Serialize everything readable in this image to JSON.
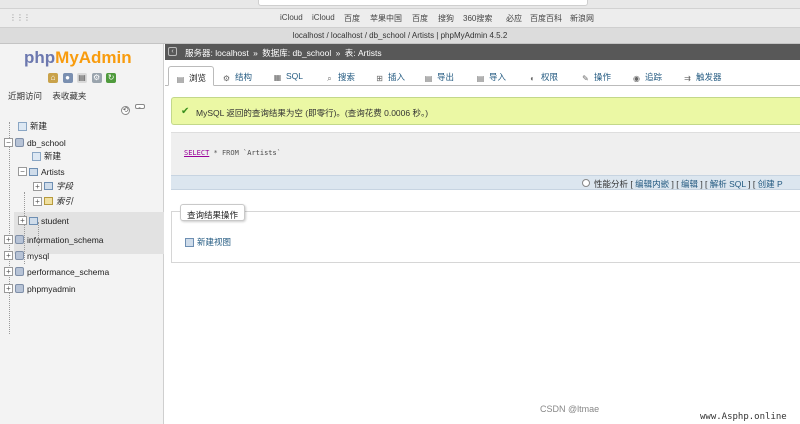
{
  "browser": {
    "bookmarks": [
      "iCloud",
      "iCloud",
      "百度",
      "苹果中国",
      "百度",
      "搜狗",
      "360搜索",
      "必应",
      "百度百科",
      "新浪网"
    ],
    "tab_title": "localhost / localhost / db_school / Artists | phpMyAdmin 4.5.2"
  },
  "sidebar": {
    "logo_part1": "php",
    "logo_part2": "MyAdmin",
    "links": [
      "近期访问",
      "表收藏夹"
    ],
    "tree": {
      "new_root": "新建",
      "db_school": "db_school",
      "db_new": "新建",
      "artists": "Artists",
      "columns": "字段",
      "indexes": "索引",
      "student": "student",
      "information_schema": "information_schema",
      "mysql": "mysql",
      "performance_schema": "performance_schema",
      "phpmyadmin": "phpmyadmin"
    }
  },
  "breadcrumb": {
    "server": "服务器: localhost",
    "database": "数据库: db_school",
    "table": "表: Artists",
    "separator": "»"
  },
  "tabs": [
    {
      "label": "浏览",
      "icon": "browse-icon"
    },
    {
      "label": "结构",
      "icon": "structure-icon"
    },
    {
      "label": "SQL",
      "icon": "sql-icon"
    },
    {
      "label": "搜索",
      "icon": "search-icon"
    },
    {
      "label": "插入",
      "icon": "insert-icon"
    },
    {
      "label": "导出",
      "icon": "export-icon"
    },
    {
      "label": "导入",
      "icon": "import-icon"
    },
    {
      "label": "权限",
      "icon": "privileges-icon"
    },
    {
      "label": "操作",
      "icon": "operations-icon"
    },
    {
      "label": "追踪",
      "icon": "tracking-icon"
    },
    {
      "label": "触发器",
      "icon": "triggers-icon"
    }
  ],
  "notice": {
    "message": "MySQL 返回的查询结果为空 (即零行)。(查询花费 0.0006 秒。)"
  },
  "sql": {
    "keyword": "SELECT",
    "rest": " * FROM ",
    "table": "`Artists`"
  },
  "options": {
    "profiling": "性能分析",
    "edit_inline": "编辑内嵌",
    "edit": "编辑",
    "explain_sql": "解析 SQL",
    "create": "创建 P"
  },
  "query_ops": {
    "legend": "查询结果操作",
    "create_view": "新建视图"
  },
  "watermark": {
    "csdn": "CSDN @ltmae",
    "site": "www.Asphp.online"
  },
  "colors": {
    "notice_bg": "#ebf8a4",
    "breadcrumb_bg": "#585858",
    "link": "#235a81",
    "logo_php": "#6c78af",
    "logo_myadmin": "#f89c0e"
  }
}
